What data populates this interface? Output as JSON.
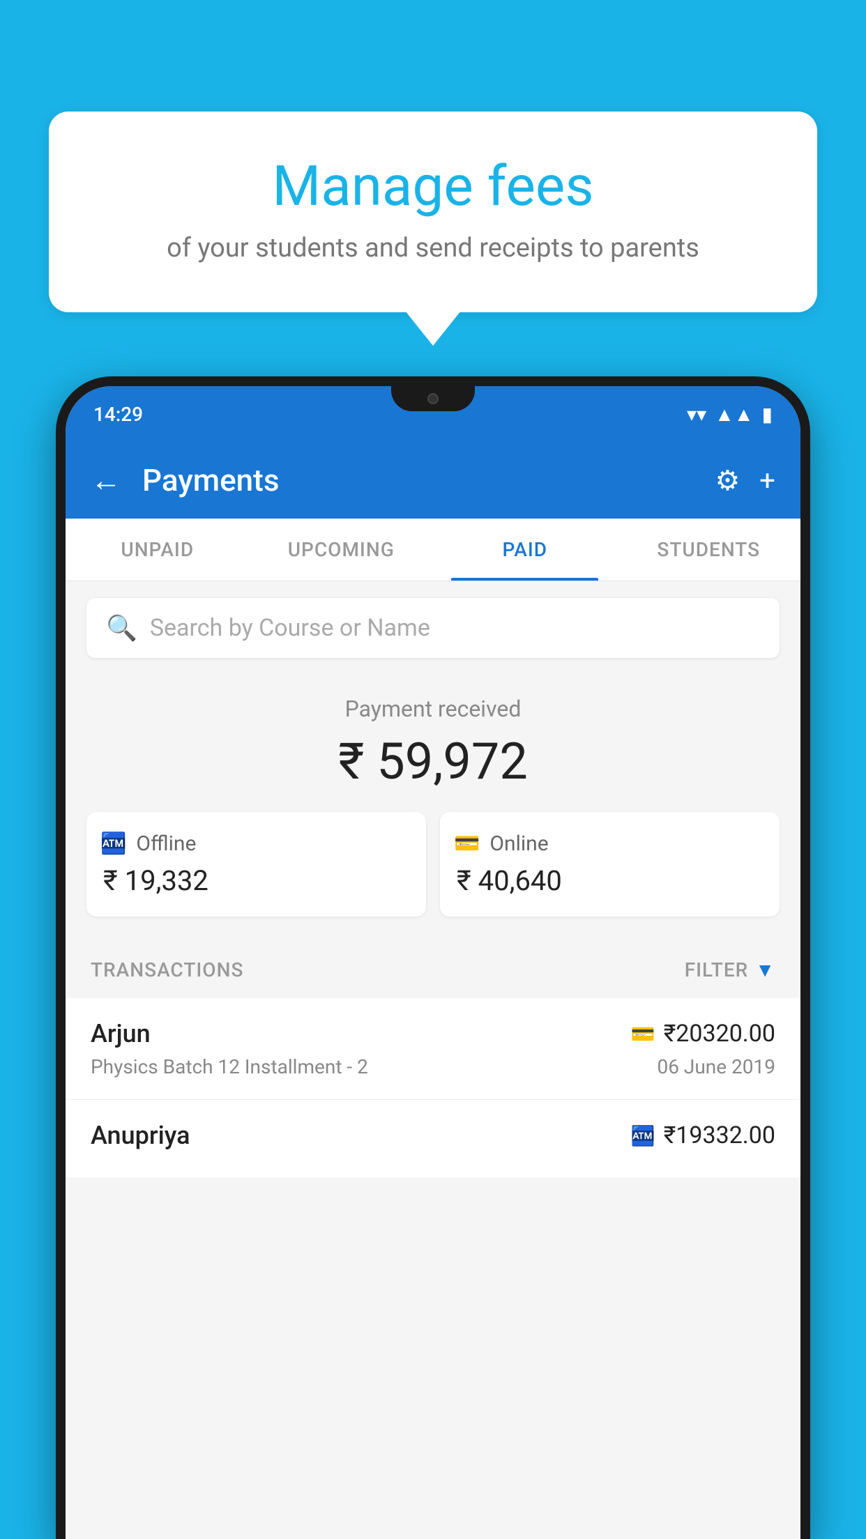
{
  "background_color": "#1ab3e8",
  "bubble": {
    "title": "Manage fees",
    "subtitle": "of your students and send receipts to parents"
  },
  "phone": {
    "status_bar": {
      "time": "14:29"
    },
    "app_bar": {
      "title": "Payments",
      "back_label": "←",
      "gear_label": "⚙",
      "plus_label": "+"
    },
    "tabs": [
      {
        "label": "UNPAID",
        "active": false
      },
      {
        "label": "UPCOMING",
        "active": false
      },
      {
        "label": "PAID",
        "active": true
      },
      {
        "label": "STUDENTS",
        "active": false
      }
    ],
    "search": {
      "placeholder": "Search by Course or Name"
    },
    "payment_summary": {
      "label": "Payment received",
      "total_amount": "₹ 59,972",
      "offline_label": "Offline",
      "offline_amount": "₹ 19,332",
      "online_label": "Online",
      "online_amount": "₹ 40,640"
    },
    "transactions": {
      "header_label": "TRANSACTIONS",
      "filter_label": "FILTER",
      "items": [
        {
          "name": "Arjun",
          "course": "Physics Batch 12 Installment - 2",
          "amount": "₹20320.00",
          "date": "06 June 2019",
          "payment_type": "online"
        },
        {
          "name": "Anupriya",
          "course": "",
          "amount": "₹19332.00",
          "date": "",
          "payment_type": "offline"
        }
      ]
    }
  }
}
